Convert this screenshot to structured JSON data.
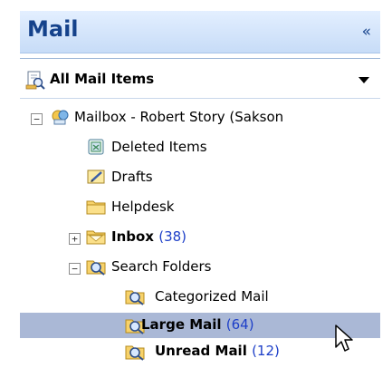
{
  "header": {
    "title": "Mail",
    "collapse_glyph": "«"
  },
  "view_selector": {
    "label": "All Mail Items",
    "icon": "all-mail-items-icon"
  },
  "tree": {
    "mailbox": {
      "label": "Mailbox - Robert Story (Sakson"
    },
    "deleted": {
      "label": "Deleted Items"
    },
    "drafts": {
      "label": "Drafts"
    },
    "helpdesk": {
      "label": "Helpdesk"
    },
    "inbox": {
      "label": "Inbox",
      "count": "(38)"
    },
    "search_folders": {
      "label": "Search Folders"
    },
    "categorized": {
      "label": "Categorized Mail"
    },
    "large": {
      "label": "Large Mail",
      "count": "(64)"
    },
    "unread": {
      "label": "Unread Mail",
      "count": "(12)"
    }
  },
  "colors": {
    "header_text": "#15428b",
    "count_text": "#1d3fc8",
    "selection": "#aab8d6"
  }
}
